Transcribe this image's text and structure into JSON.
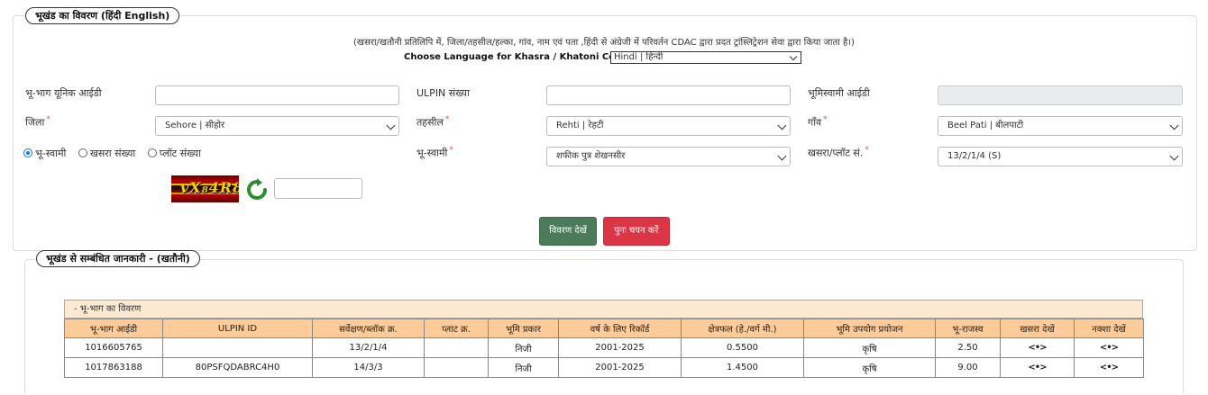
{
  "section1": {
    "legend": "भूखंड का विवरण  (हिंदी  English)",
    "note": "(खसरा/खतौनी प्रतिलिपि में, जिला/तहसील/हल्का, गांव, नाम एवं पता ,हिंदी से अंग्रेजी में परिवर्तन CDAC द्वारा प्रदत ट्रांस्लिट्रेशन सेवा द्वारा किया जाता है।)",
    "language_label": "Choose Language for Khasra / Khatoni Copy:",
    "language_value": "Hindi | हिन्दी"
  },
  "form": {
    "parcel_id_label": "भू-भाग यूनिक आईडी",
    "parcel_id_value": "",
    "ulpin_label": "ULPIN संख्या",
    "ulpin_value": "",
    "owner_id_label": "भूमिस्वामी आईडी",
    "owner_id_value": "",
    "district_label": "जिला",
    "district_value": "Sehore | सीहोर",
    "tehsil_label": "तहसील",
    "tehsil_value": "Rehti | रेहटी",
    "village_label": "गाँव",
    "village_value": "Beel Pati | बीलपाटी",
    "radio_owner": "भू-स्वामी",
    "radio_khasra": "खसरा संख्या",
    "radio_plot": "प्लॉट संख्या",
    "owner_label": "भू-स्वामी",
    "owner_value": "शफीक पुत्र शेखनसीर",
    "khasra_label": "खसरा/प्लॉट सं.",
    "khasra_value": "13/2/1/4 (S)",
    "required_mark": "*",
    "captcha_text": "vX₈4R8",
    "captcha_value": ""
  },
  "buttons": {
    "view": "विवरण देखें",
    "reset": "पुनः चयन करें"
  },
  "section2": {
    "legend": "भूखंड से सम्बंधित जानकारी -   (खतौनी)",
    "sub_heading": "- भू-भाग का विवरण",
    "columns": [
      "भू-भाग आईडी",
      "ULPIN ID",
      "सर्वेक्षण/ब्लॉक क्र.",
      "प्लाट क्र.",
      "भूमि प्रकार",
      "वर्ष के लिए रिकॉर्ड",
      "क्षेत्रफल (हे./वर्ग मी.)",
      "भूमि उपयोग प्रयोजन",
      "भू-राजस्व",
      "खसरा देखें",
      "नक्शा देखें"
    ],
    "rows": [
      [
        "1016605765",
        "",
        "13/2/1/4",
        "",
        "निजी",
        "2001-2025",
        "0.5500",
        "कृषि",
        "2.50",
        "<•>",
        "<•>"
      ],
      [
        "1017863188",
        "80PSFQDABRC4H0",
        "14/3/3",
        "",
        "निजी",
        "2001-2025",
        "1.4500",
        "कृषि",
        "9.00",
        "<•>",
        "<•>"
      ]
    ]
  }
}
